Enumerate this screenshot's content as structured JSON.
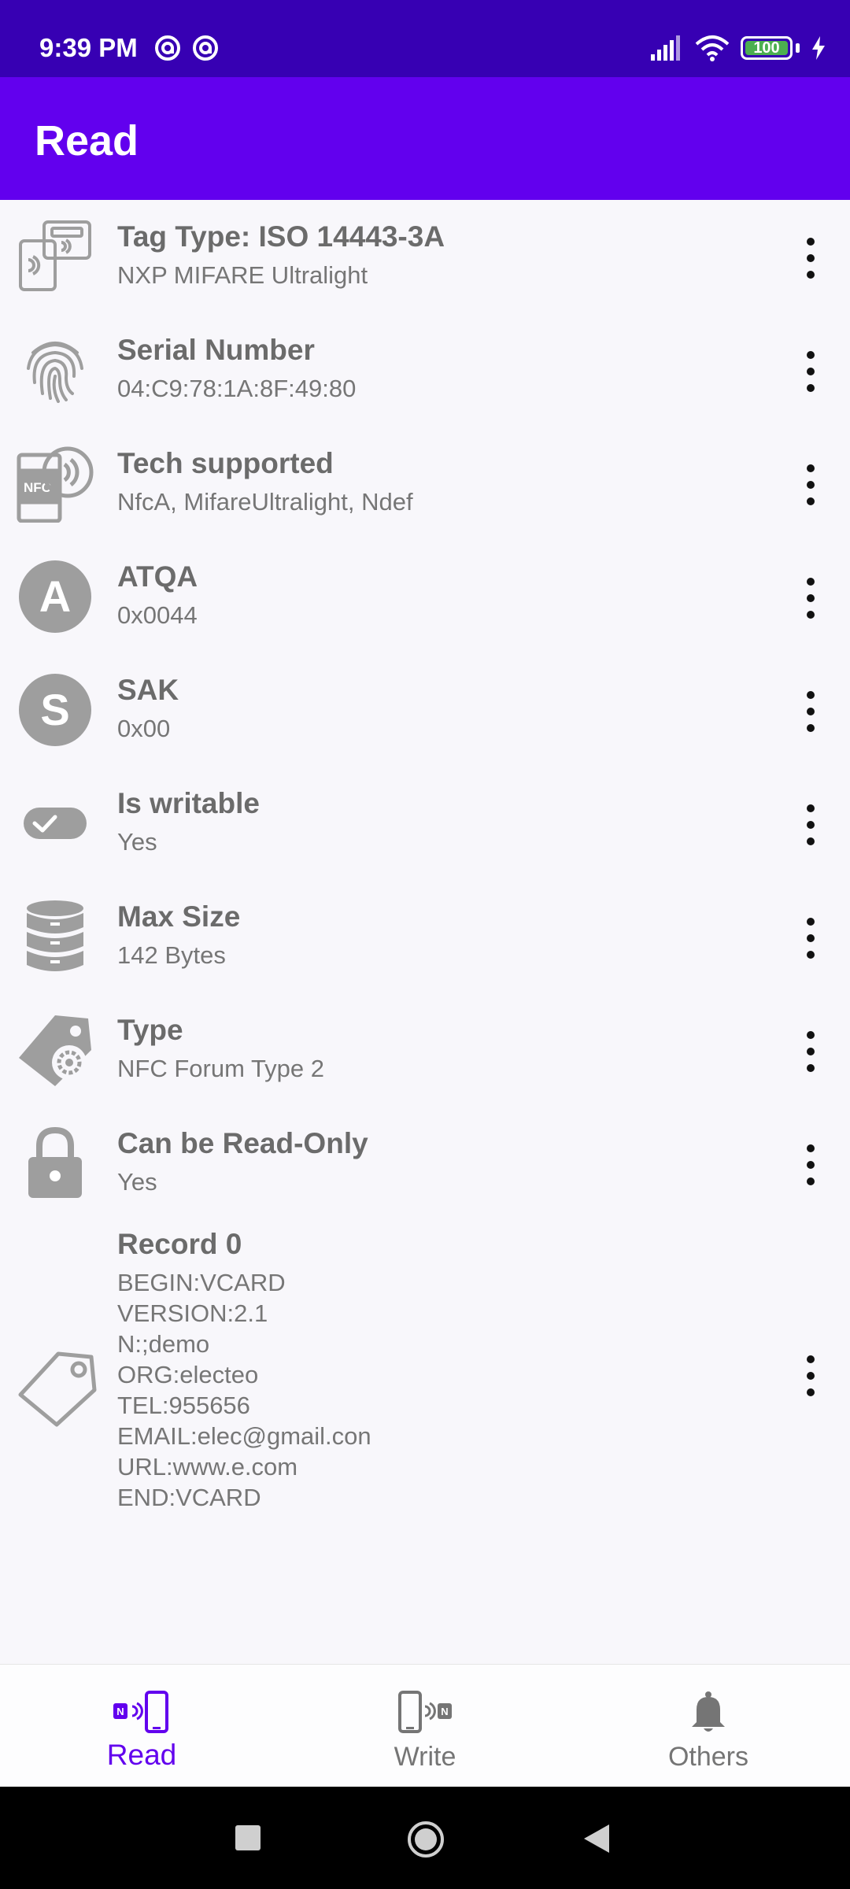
{
  "status_bar": {
    "time": "9:39 PM",
    "battery": "100"
  },
  "app_bar": {
    "title": "Read"
  },
  "items": [
    {
      "title": "Tag Type: ISO 14443-3A",
      "subtitle": "NXP MIFARE Ultralight",
      "icon": "nfc-cards-icon"
    },
    {
      "title": "Serial Number",
      "subtitle": "04:C9:78:1A:8F:49:80",
      "icon": "fingerprint-icon"
    },
    {
      "title": "Tech supported",
      "subtitle": "NfcA, MifareUltralight, Ndef",
      "icon": "nfc-phone-icon"
    },
    {
      "title": "ATQA",
      "subtitle": "0x0044",
      "icon": "letter-a-icon",
      "letter": "A"
    },
    {
      "title": "SAK",
      "subtitle": "0x00",
      "icon": "letter-s-icon",
      "letter": "S"
    },
    {
      "title": "Is writable",
      "subtitle": "Yes",
      "icon": "toggle-check-icon"
    },
    {
      "title": "Max Size",
      "subtitle": "142 Bytes",
      "icon": "database-icon"
    },
    {
      "title": "Type",
      "subtitle": "NFC Forum Type 2",
      "icon": "tag-gear-icon"
    },
    {
      "title": "Can be Read-Only",
      "subtitle": "Yes",
      "icon": "lock-icon"
    }
  ],
  "record": {
    "title": "Record 0",
    "lines": [
      "BEGIN:VCARD",
      "VERSION:2.1",
      "N:;demo",
      "ORG:electeo",
      "TEL:955656",
      "EMAIL:elec@gmail.con",
      "URL:www.e.com",
      "END:VCARD"
    ],
    "icon": "tag-outline-icon"
  },
  "bottom_nav": [
    {
      "label": "Read",
      "active": true,
      "icon": "nfc-read-icon"
    },
    {
      "label": "Write",
      "active": false,
      "icon": "nfc-write-icon"
    },
    {
      "label": "Others",
      "active": false,
      "icon": "bell-icon"
    }
  ],
  "colors": {
    "status_bar": "#3700b3",
    "app_bar": "#6200ee",
    "accent": "#6200ee",
    "icon_gray": "#9e9e9e"
  }
}
